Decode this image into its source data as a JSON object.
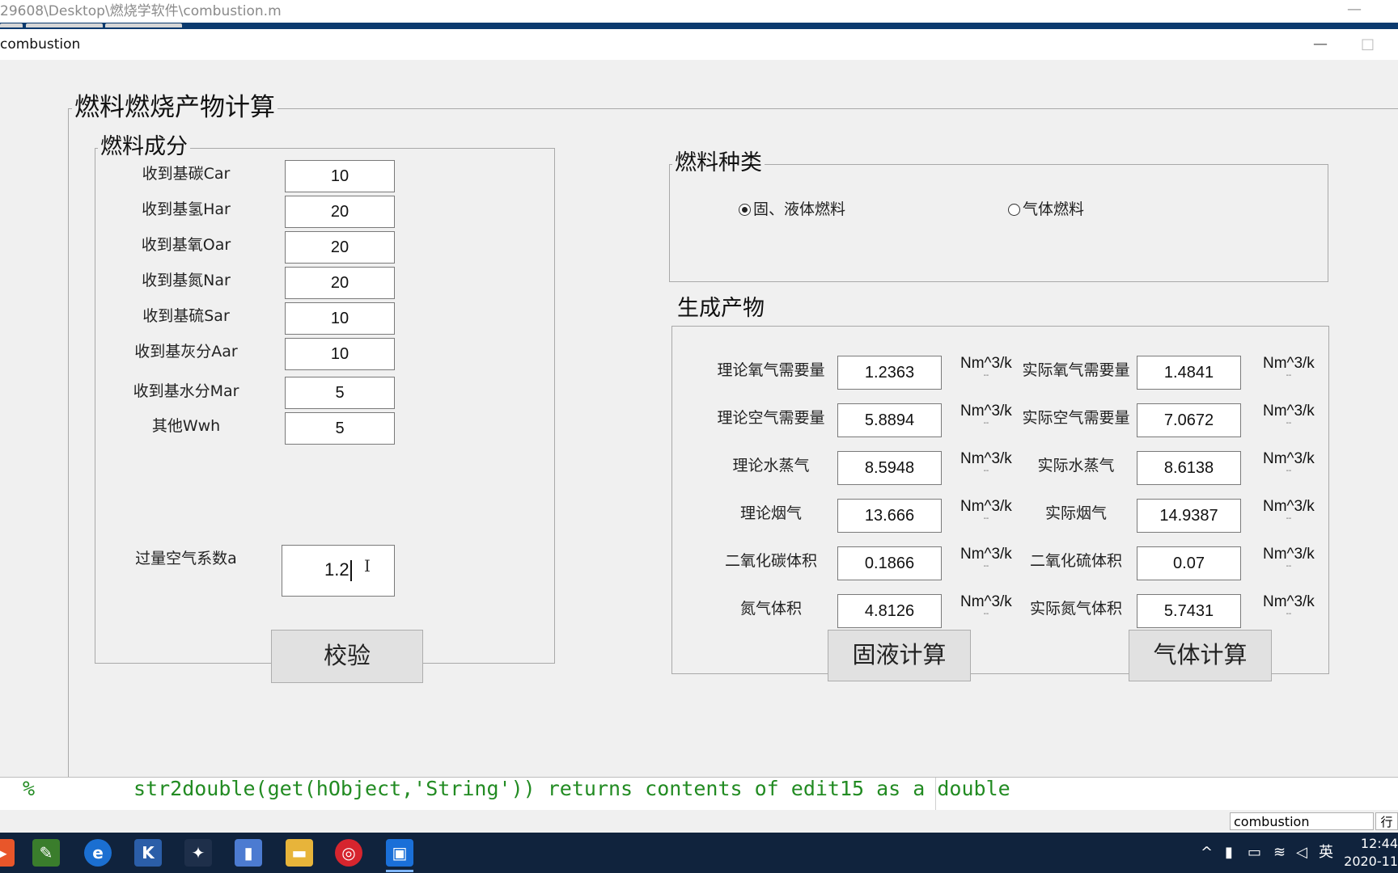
{
  "editor": {
    "title_path": "29608\\Desktop\\燃烧学软件\\combustion.m",
    "minimize_glyph": "—"
  },
  "app": {
    "window_title": "combustion",
    "minimize_glyph": "—",
    "maximize_glyph": "□"
  },
  "main_panel": {
    "title": "燃料燃烧产物计算"
  },
  "fuel_composition": {
    "title": "燃料成分",
    "rows": [
      {
        "label": "收到基碳Car",
        "value": "10"
      },
      {
        "label": "收到基氢Har",
        "value": "20"
      },
      {
        "label": "收到基氧Oar",
        "value": "20"
      },
      {
        "label": "收到基氮Nar",
        "value": "20"
      },
      {
        "label": "收到基硫Sar",
        "value": "10"
      },
      {
        "label": "收到基灰分Aar",
        "value": "10"
      },
      {
        "label": "收到基水分Mar",
        "value": "5"
      },
      {
        "label": "其他Wwh",
        "value": "5"
      }
    ],
    "excess_air_label": "过量空气系数a",
    "excess_air_value": "1.2"
  },
  "fuel_type": {
    "title": "燃料种类",
    "options": [
      {
        "label": "固、液体燃料",
        "selected": true
      },
      {
        "label": "气体燃料",
        "selected": false
      }
    ]
  },
  "products": {
    "title": "生成产物",
    "unit": "Nm^3/k",
    "unit_tick": "--",
    "rows": [
      {
        "left_label": "理论氧气需要量",
        "left_value": "1.2363",
        "right_label": "实际氧气需要量",
        "right_value": "1.4841"
      },
      {
        "left_label": "理论空气需要量",
        "left_value": "5.8894",
        "right_label": "实际空气需要量",
        "right_value": "7.0672"
      },
      {
        "left_label": "理论水蒸气",
        "left_value": "8.5948",
        "right_label": "实际水蒸气",
        "right_value": "8.6138"
      },
      {
        "left_label": "理论烟气",
        "left_value": "13.666",
        "right_label": "实际烟气",
        "right_value": "14.9387"
      },
      {
        "left_label": "二氧化碳体积",
        "left_value": "0.1866",
        "right_label": "二氧化硫体积",
        "right_value": "0.07"
      },
      {
        "left_label": "氮气体积",
        "left_value": "4.8126",
        "right_label": "实际氮气体积",
        "right_value": "5.7431"
      }
    ]
  },
  "buttons": {
    "verify": "校验",
    "solid_liquid_calc": "固液计算",
    "gas_calc": "气体计算"
  },
  "code_line": {
    "prefix": "%",
    "text": "str2double(get(hObject,'String')) returns contents of edit15 as a double"
  },
  "status_bar": {
    "filename": "combustion",
    "row_label": "行"
  },
  "taskbar": {
    "icons": [
      "app-red-icon",
      "notes-icon",
      "edge-icon",
      "kingsoft-icon",
      "paint-icon",
      "file-icon",
      "folder-icon",
      "netease-music-icon",
      "meeting-icon"
    ],
    "ime": "英",
    "time": "12:44",
    "date": "2020-11"
  }
}
